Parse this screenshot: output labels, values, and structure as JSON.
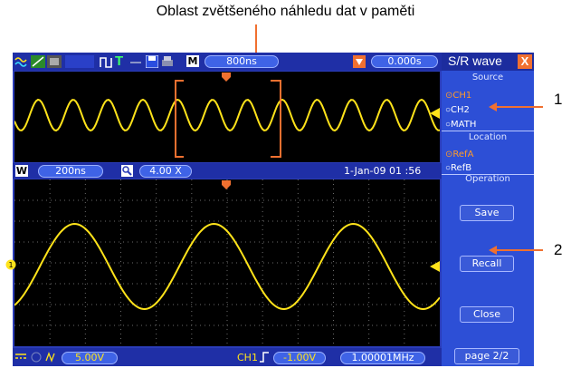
{
  "annotations": {
    "top_caption": "Oblast zvětšeného náhledu dat v paměti",
    "callout_1": "1",
    "callout_2": "2"
  },
  "toolbar": {
    "mode_tag": "M",
    "timebase": "800ns",
    "trigger_icon": "T",
    "offset": "0.000s"
  },
  "panel": {
    "title": "S/R wave",
    "close_label": "X",
    "source_header": "Source",
    "sources": [
      {
        "label": "CH1",
        "selected": true
      },
      {
        "label": "CH2",
        "selected": false
      },
      {
        "label": "MATH",
        "selected": false
      }
    ],
    "location_header": "Location",
    "locations": [
      {
        "label": "RefA",
        "selected": true
      },
      {
        "label": "RefB",
        "selected": false
      }
    ],
    "operation_header": "Operation",
    "save_label": "Save",
    "recall_label": "Recall",
    "close_btn_label": "Close",
    "page_label": "page 2/2"
  },
  "zoom_bar": {
    "window_tag": "W",
    "window_timebase": "200ns",
    "zoom_factor": "4.00 X",
    "datetime": "1-Jan-09 01 :56"
  },
  "status_bar": {
    "volts_div": "5.00V",
    "channel": "CH1",
    "trigger_level": "-1.00V",
    "frequency": "1.00001MHz"
  },
  "colors": {
    "trace": "#ffe31a",
    "frame_blue": "#2a3cb8",
    "accent_orange": "#f07030"
  },
  "icons": [
    "waveform-icon",
    "trigger-icon",
    "save-disk-icon",
    "printer-icon",
    "zoom-icon",
    "coupling-dc-icon",
    "bandwidth-icon",
    "rising-edge-icon",
    "trigger-marker-icon"
  ]
}
